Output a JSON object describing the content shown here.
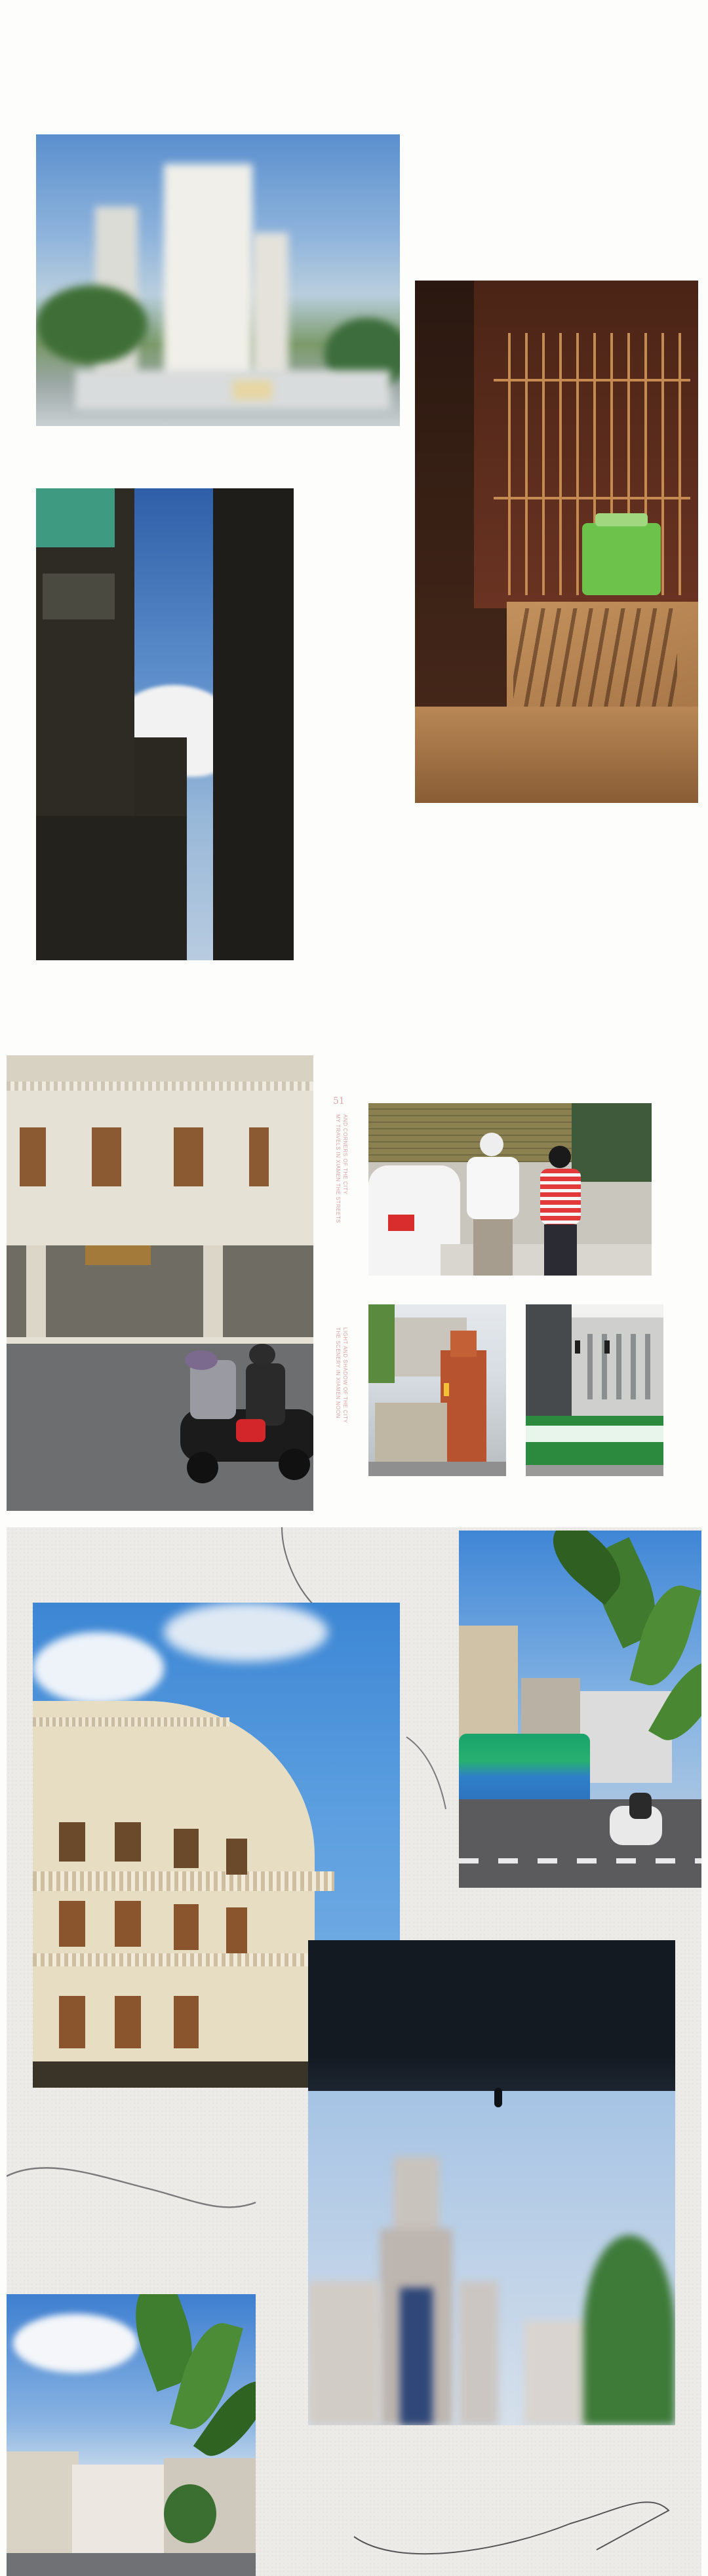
{
  "page": {
    "page_number": "51",
    "captions": [
      "MY TRAVELS IN XIAMEN THE STREETS",
      "AND CORNERS OF THE CITY",
      "THE SCENERY IN XIAMEN NOON",
      "LIGHT AND SHADOW OF THE CITY"
    ]
  },
  "photos": {
    "blurry_city": "blurred-skyline-photo",
    "window_grill": "window-grill-with-green-watering-can-photo",
    "balconies_sky": "balconies-against-blue-sky-photo",
    "arcade_scooter": "arcade-building-with-scooter-riders-photo",
    "couple_street": "elderly-couple-crossing-street-photo",
    "church_street": "red-church-street-photo",
    "bus_traffic": "bus-and-traffic-light-photo",
    "round_building": "round-colonial-building-photo",
    "bus_leaves": "bus-street-with-leaves-photo",
    "church_blur": "blurred-church-tower-photo",
    "city_leaves": "city-view-with-leaves-photo"
  },
  "colors": {
    "background": "#fdfdfb",
    "paper": "#ecebe7",
    "caption_accent": "#d9a3a3",
    "sky": "#4a8ed8"
  }
}
